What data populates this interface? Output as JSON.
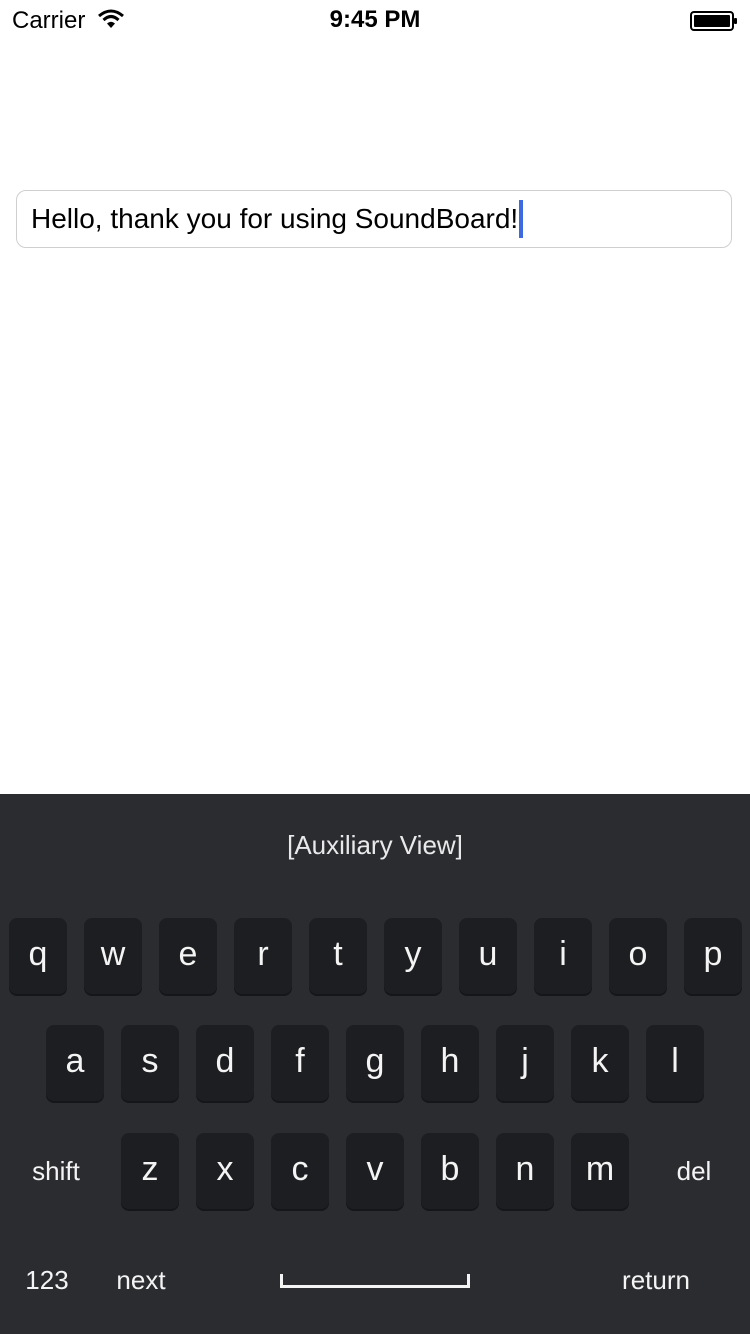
{
  "status_bar": {
    "carrier": "Carrier",
    "time": "9:45 PM",
    "wifi_icon": "wifi-icon",
    "battery_icon": "battery-full-icon"
  },
  "text_field": {
    "value": "Hello, thank you for using SoundBoard!",
    "caret_color": "#3d6ae0"
  },
  "keyboard": {
    "auxiliary_label": "[Auxiliary View]",
    "background": "#2b2c30",
    "row1": [
      "q",
      "w",
      "e",
      "r",
      "t",
      "y",
      "u",
      "i",
      "o",
      "p"
    ],
    "row2": [
      "a",
      "s",
      "d",
      "f",
      "g",
      "h",
      "j",
      "k",
      "l"
    ],
    "row3": [
      "z",
      "x",
      "c",
      "v",
      "b",
      "n",
      "m"
    ],
    "shift_label": "shift",
    "delete_label": "del",
    "numbers_label": "123",
    "next_label": "next",
    "return_label": "return"
  }
}
